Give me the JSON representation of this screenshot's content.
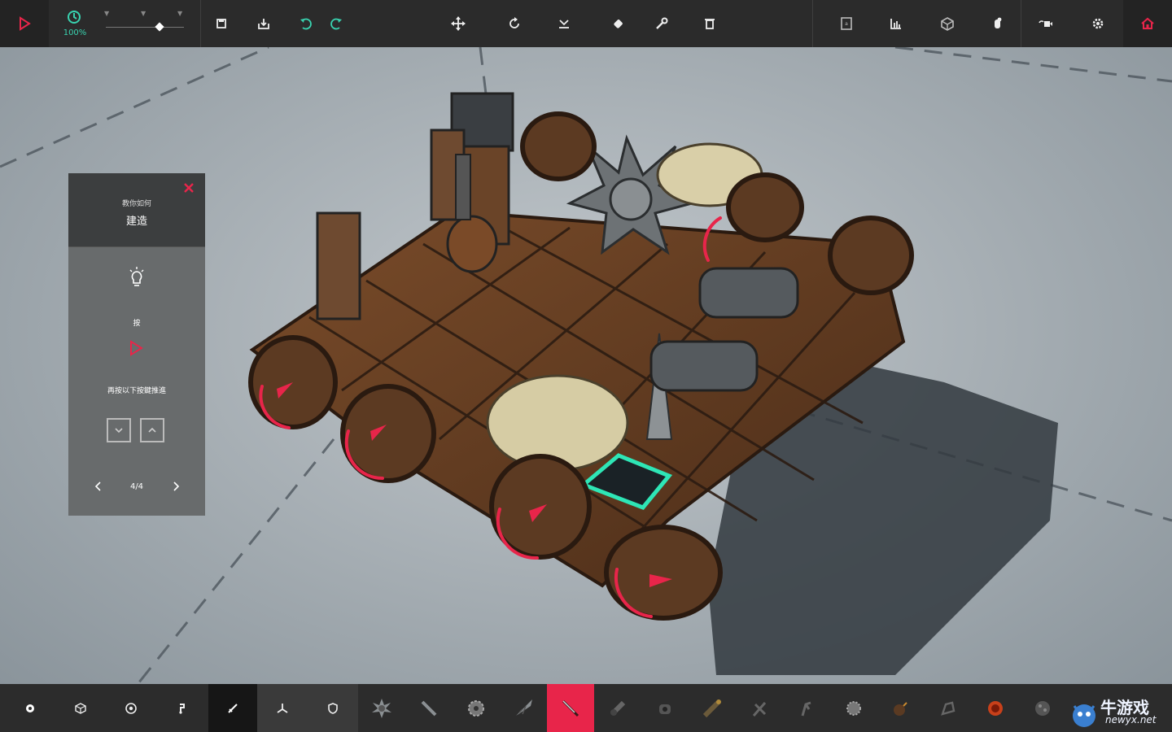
{
  "toolbar": {
    "timescale_pct": "100%",
    "timescale_level": 0.72,
    "items": [
      "play-icon",
      "timescale-icon",
      "save-icon",
      "load-icon",
      "undo-icon",
      "redo-icon",
      "translate-icon",
      "rotate-icon",
      "flip-icon",
      "eraser-icon",
      "wrench-icon",
      "trash-icon",
      "keybinds-icon",
      "stats-icon",
      "view-icon",
      "center-of-mass-icon",
      "camera-icon",
      "settings-icon",
      "home-icon"
    ]
  },
  "tutorial": {
    "subtitle": "教你如何",
    "title": "建造",
    "press_label": "按",
    "hint": "再按以下按鍵推進",
    "page": "4/4"
  },
  "bottom": {
    "categories": [
      "basic",
      "blocks",
      "mechanical",
      "flight",
      "weaponry",
      "armour",
      "utility"
    ],
    "active_category": "weaponry",
    "blocks": [
      "spike-ball",
      "spike",
      "spinning-blade",
      "drill",
      "sword",
      "cannon",
      "shrapnel-cannon",
      "flamethrower",
      "crossbow",
      "grabber",
      "grenade",
      "bomb",
      "vacuum",
      "fireball",
      "boulder"
    ],
    "active_block": "sword"
  },
  "watermark": {
    "title": "牛游戏",
    "url": "newyx.net"
  },
  "colors": {
    "accent": "#e8254a",
    "teal": "#39d3b0",
    "bar": "#2b2b2b",
    "panel_dark": "#3c3e3f",
    "panel_light": "#686b6c"
  }
}
